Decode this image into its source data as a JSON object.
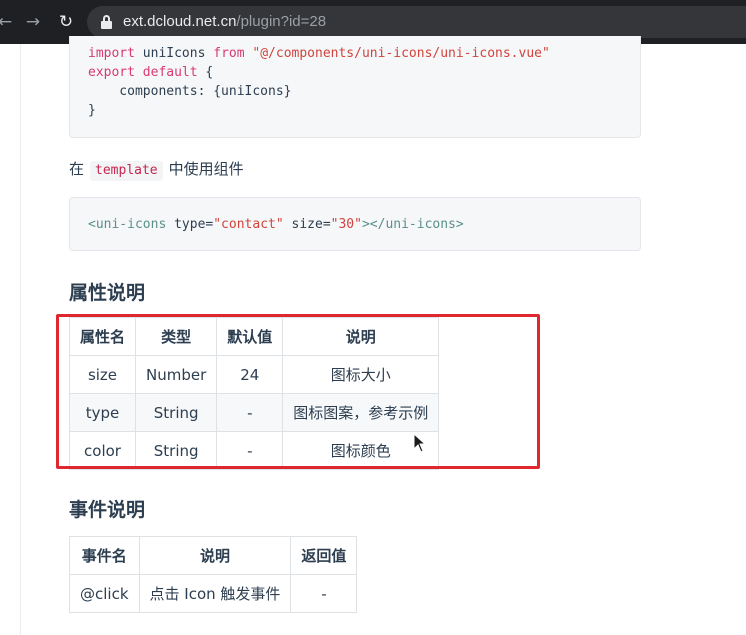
{
  "browser": {
    "url_host": "ext.dcloud.net.cn",
    "url_path": "/plugin?id=28"
  },
  "code_block_1": {
    "lines": [
      [
        {
          "t": "import ",
          "c": "kw"
        },
        {
          "t": "uniIcons ",
          "c": "plain"
        },
        {
          "t": "from ",
          "c": "kw"
        },
        {
          "t": "\"@/components/uni-icons/uni-icons.vue\"",
          "c": "str"
        }
      ],
      [
        {
          "t": "export default ",
          "c": "kw"
        },
        {
          "t": "{",
          "c": "plain"
        }
      ],
      [
        {
          "t": "    components: {uniIcons}",
          "c": "plain"
        }
      ],
      [
        {
          "t": "}",
          "c": "plain"
        }
      ]
    ]
  },
  "template_intro": {
    "before": "在",
    "code": "template",
    "after": "中使用组件"
  },
  "code_block_2": {
    "lines": [
      [
        {
          "t": "<uni-icons ",
          "c": "tag"
        },
        {
          "t": "type=",
          "c": "attr"
        },
        {
          "t": "\"contact\" ",
          "c": "str"
        },
        {
          "t": "size=",
          "c": "attr"
        },
        {
          "t": "\"30\"",
          "c": "str"
        },
        {
          "t": "></uni-icons>",
          "c": "tag"
        }
      ]
    ]
  },
  "props_section": {
    "title": "属性说明",
    "headers": [
      "属性名",
      "类型",
      "默认值",
      "说明"
    ],
    "rows": [
      [
        "size",
        "Number",
        "24",
        "图标大小"
      ],
      [
        "type",
        "String",
        "-",
        "图标图案，参考示例"
      ],
      [
        "color",
        "String",
        "-",
        "图标颜色"
      ]
    ],
    "highlight_color": "#e0262f"
  },
  "events_section": {
    "title": "事件说明",
    "headers": [
      "事件名",
      "说明",
      "返回值"
    ],
    "rows": [
      [
        "@click",
        "点击 Icon 触发事件",
        "-"
      ]
    ]
  }
}
